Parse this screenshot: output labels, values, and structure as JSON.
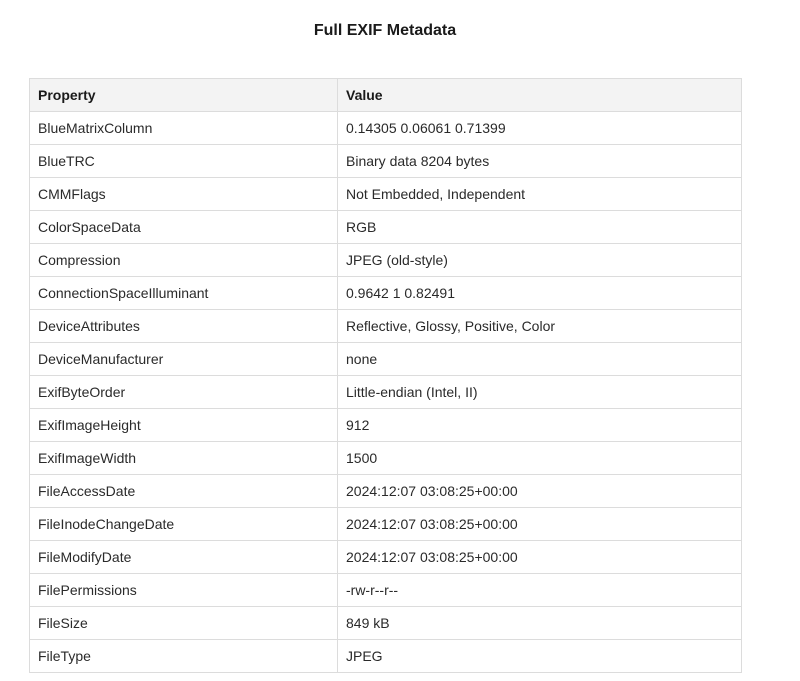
{
  "title": "Full EXIF Metadata",
  "table": {
    "headers": [
      "Property",
      "Value"
    ],
    "rows": [
      {
        "property": "BlueMatrixColumn",
        "value": "0.14305 0.06061 0.71399"
      },
      {
        "property": "BlueTRC",
        "value": "Binary data 8204 bytes"
      },
      {
        "property": "CMMFlags",
        "value": "Not Embedded, Independent"
      },
      {
        "property": "ColorSpaceData",
        "value": "RGB"
      },
      {
        "property": "Compression",
        "value": "JPEG (old-style)"
      },
      {
        "property": "ConnectionSpaceIlluminant",
        "value": "0.9642 1 0.82491"
      },
      {
        "property": "DeviceAttributes",
        "value": "Reflective, Glossy, Positive, Color"
      },
      {
        "property": "DeviceManufacturer",
        "value": "none"
      },
      {
        "property": "ExifByteOrder",
        "value": "Little-endian (Intel, II)"
      },
      {
        "property": "ExifImageHeight",
        "value": "912"
      },
      {
        "property": "ExifImageWidth",
        "value": "1500"
      },
      {
        "property": "FileAccessDate",
        "value": "2024:12:07 03:08:25+00:00"
      },
      {
        "property": "FileInodeChangeDate",
        "value": "2024:12:07 03:08:25+00:00"
      },
      {
        "property": "FileModifyDate",
        "value": "2024:12:07 03:08:25+00:00"
      },
      {
        "property": "FilePermissions",
        "value": "-rw-r--r--"
      },
      {
        "property": "FileSize",
        "value": "849 kB"
      },
      {
        "property": "FileType",
        "value": "JPEG"
      }
    ]
  }
}
